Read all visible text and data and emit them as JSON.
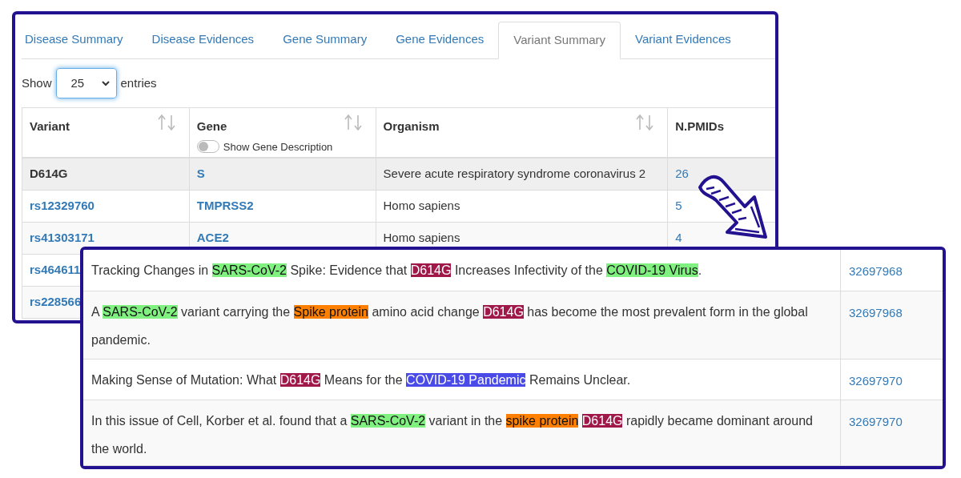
{
  "tabs": [
    {
      "label": "Disease Summary",
      "selected": false
    },
    {
      "label": "Disease Evidences",
      "selected": false
    },
    {
      "label": "Gene Summary",
      "selected": false
    },
    {
      "label": "Gene Evidences",
      "selected": false
    },
    {
      "label": "Variant Summary",
      "selected": true
    },
    {
      "label": "Variant Evidences",
      "selected": false
    }
  ],
  "length_menu": {
    "before": "Show",
    "value": "25",
    "after": "entries"
  },
  "table": {
    "columns": [
      {
        "label": "Variant",
        "sortable": true
      },
      {
        "label": "Gene",
        "sortable": true
      },
      {
        "label": "Organism",
        "sortable": true
      },
      {
        "label": "N.PMIDs",
        "sortable": false
      }
    ],
    "gene_toggle": {
      "label": "Show Gene Description",
      "on": false
    },
    "rows": [
      {
        "cells": [
          "D614G",
          "S",
          "Severe acute respiratory syndrome coronavirus 2",
          "26"
        ],
        "selected": true
      },
      {
        "cells": [
          "rs12329760",
          "TMPRSS2",
          "Homo sapiens",
          "5"
        ],
        "selected": false
      },
      {
        "cells": [
          "rs41303171",
          "ACE2",
          "Homo sapiens",
          "4"
        ],
        "selected": false
      },
      {
        "cells": [
          "rs464611"
        ],
        "selected": false
      },
      {
        "cells": [
          "rs228566"
        ],
        "selected": false
      }
    ]
  },
  "evidences": [
    {
      "sentence": [
        {
          "kind": "plain",
          "text": "Tracking Changes in "
        },
        {
          "kind": "mark",
          "text": "SARS-CoV-2",
          "color": "#80f080"
        },
        {
          "kind": "plain",
          "text": " Spike: Evidence that "
        },
        {
          "kind": "mark",
          "text": "D614G",
          "color": "#a01848"
        },
        {
          "kind": "plain",
          "text": " Increases Infectivity of the "
        },
        {
          "kind": "mark",
          "text": "COVID-19 Virus",
          "color": "#80f080"
        },
        {
          "kind": "plain",
          "text": "."
        }
      ],
      "pmid": "32697968"
    },
    {
      "sentence": [
        {
          "kind": "plain",
          "text": "A "
        },
        {
          "kind": "mark",
          "text": "SARS-CoV-2",
          "color": "#80f080"
        },
        {
          "kind": "plain",
          "text": " variant carrying the "
        },
        {
          "kind": "mark",
          "text": "Spike protein",
          "color": "#ff8000"
        },
        {
          "kind": "plain",
          "text": " amino acid change "
        },
        {
          "kind": "mark",
          "text": "D614G",
          "color": "#a01848"
        },
        {
          "kind": "plain",
          "text": " has become the most prevalent form in the global pandemic."
        }
      ],
      "pmid": "32697968"
    },
    {
      "sentence": [
        {
          "kind": "plain",
          "text": "Making Sense of Mutation: What "
        },
        {
          "kind": "mark",
          "text": "D614G",
          "color": "#a01848"
        },
        {
          "kind": "plain",
          "text": " Means for the "
        },
        {
          "kind": "mark",
          "text": "COVID-19 Pandemic",
          "color": "#4a4ae8"
        },
        {
          "kind": "plain",
          "text": " Remains Unclear."
        }
      ],
      "pmid": "32697970"
    },
    {
      "sentence": [
        {
          "kind": "plain",
          "text": "In this issue of Cell, Korber et al. found that a "
        },
        {
          "kind": "mark",
          "text": "SARS-CoV-2",
          "color": "#80f080"
        },
        {
          "kind": "plain",
          "text": " variant in the "
        },
        {
          "kind": "mark",
          "text": "spike protein",
          "color": "#ff8000"
        },
        {
          "kind": "mark",
          "text": "D614G",
          "color": "#a01848"
        },
        {
          "kind": "plain",
          "text": " rapidly became dominant around the world."
        }
      ],
      "pmid": "32697970"
    }
  ]
}
